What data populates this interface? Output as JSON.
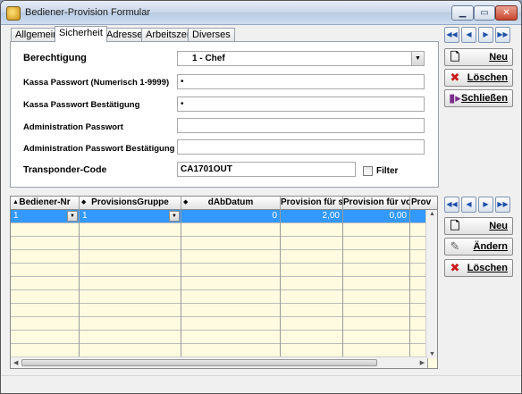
{
  "window": {
    "title": "Bediener-Provision Formular"
  },
  "tabs": [
    "Allgemein",
    "Sicherheit",
    "Adresse",
    "Arbeitszeit",
    "Diverses"
  ],
  "active_tab": "Sicherheit",
  "form": {
    "berechtigung_label": "Berechtigung",
    "berechtigung_value": "1 - Chef",
    "kassa_pw_label": "Kassa Passwort (Numerisch 1-9999)",
    "kassa_pw_value": "•",
    "kassa_pw_confirm_label": "Kassa Passwort Bestätigung",
    "kassa_pw_confirm_value": "•",
    "admin_pw_label": "Administration Passwort",
    "admin_pw_value": "",
    "admin_pw_confirm_label": "Administration Passwort Bestätigung",
    "admin_pw_confirm_value": "",
    "transponder_label": "Transponder-Code",
    "transponder_value": "CA1701OUT",
    "filter_label": "Filter",
    "filter_checked": false
  },
  "top_buttons": {
    "neu": "Neu",
    "loeschen": "Löschen",
    "schliessen": "Schließen"
  },
  "grid_buttons": {
    "neu": "Neu",
    "aendern": "Ändern",
    "loeschen": "Löschen"
  },
  "grid": {
    "columns": [
      "Bediener-Nr",
      "ProvisionsGruppe",
      "dAbDatum",
      "Provision für se",
      "Provision für von",
      "Prov"
    ],
    "rows": [
      [
        "1",
        "1",
        "0",
        "2,00",
        "0,00",
        ""
      ]
    ],
    "empty_rows": 11
  },
  "icons": {
    "app": "app-icon",
    "first": "first-record-icon",
    "prev": "previous-record-icon",
    "next": "next-record-icon",
    "last": "last-record-icon",
    "new": "new-document-icon",
    "delete": "delete-x-icon",
    "close": "exit-door-icon",
    "edit": "edit-pencil-icon"
  }
}
